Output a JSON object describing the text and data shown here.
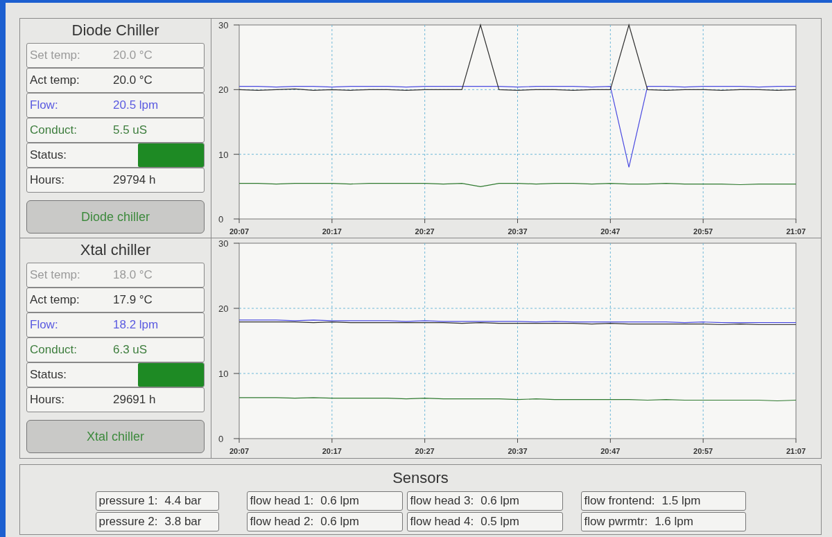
{
  "chillers": [
    {
      "title": "Diode Chiller",
      "rows": [
        {
          "kind": "setpoint",
          "label": "Set temp:",
          "value": "20.0 °C"
        },
        {
          "kind": "actual",
          "label": "Act temp:",
          "value": "20.0 °C"
        },
        {
          "kind": "flow",
          "label": "Flow:",
          "value": "20.5 lpm"
        },
        {
          "kind": "conduct",
          "label": "Conduct:",
          "value": "5.5 uS"
        },
        {
          "kind": "status",
          "label": "Status:",
          "color": "#1e8a24"
        },
        {
          "kind": "hours",
          "label": "Hours:",
          "value": "29794 h"
        }
      ],
      "button": "Diode chiller",
      "chart_data": {
        "type": "line",
        "grid": true,
        "categories": [
          "20:07",
          null,
          null,
          null,
          null,
          "20:17",
          null,
          null,
          null,
          null,
          "20:27",
          null,
          null,
          null,
          null,
          "20:37",
          null,
          null,
          null,
          null,
          "20:47",
          null,
          null,
          null,
          null,
          "20:57",
          null,
          null,
          null,
          null,
          "21:07"
        ],
        "ylim": [
          0,
          30
        ],
        "yticks": [
          0,
          10,
          20,
          30
        ],
        "series": [
          {
            "color": "#4a4ae0",
            "values": [
              20.5,
              20.5,
              20.4,
              20.5,
              20.5,
              20.4,
              20.5,
              20.5,
              20.5,
              20.4,
              20.5,
              20.5,
              20.5,
              20.5,
              20.5,
              20.4,
              20.5,
              20.5,
              20.5,
              20.4,
              20.5,
              8,
              20.5,
              20.5,
              20.4,
              20.5,
              20.5,
              20.5,
              20.4,
              20.5,
              20.5
            ]
          },
          {
            "color": "#303030",
            "values": [
              20.0,
              19.9,
              20.0,
              20.1,
              19.9,
              20.0,
              19.9,
              20.0,
              20.0,
              19.9,
              20.0,
              20.0,
              20.0,
              30,
              20.0,
              19.9,
              20.0,
              20.0,
              19.9,
              20.0,
              20.0,
              30,
              20.0,
              19.9,
              20.0,
              20.0,
              19.9,
              20.0,
              20.0,
              19.9,
              20.0
            ]
          },
          {
            "color": "#2f7a2f",
            "values": [
              5.5,
              5.5,
              5.4,
              5.5,
              5.5,
              5.5,
              5.4,
              5.5,
              5.5,
              5.5,
              5.5,
              5.4,
              5.5,
              5.0,
              5.5,
              5.5,
              5.4,
              5.5,
              5.5,
              5.4,
              5.5,
              5.4,
              5.4,
              5.5,
              5.4,
              5.4,
              5.4,
              5.3,
              5.4,
              5.4,
              5.4
            ]
          }
        ]
      }
    },
    {
      "title": "Xtal chiller",
      "rows": [
        {
          "kind": "setpoint",
          "label": "Set temp:",
          "value": "18.0 °C"
        },
        {
          "kind": "actual",
          "label": "Act temp:",
          "value": "17.9 °C"
        },
        {
          "kind": "flow",
          "label": "Flow:",
          "value": "18.2 lpm"
        },
        {
          "kind": "conduct",
          "label": "Conduct:",
          "value": "6.3 uS"
        },
        {
          "kind": "status",
          "label": "Status:",
          "color": "#1e8a24"
        },
        {
          "kind": "hours",
          "label": "Hours:",
          "value": "29691 h"
        }
      ],
      "button": "Xtal chiller",
      "chart_data": {
        "type": "line",
        "grid": true,
        "categories": [
          "20:07",
          null,
          null,
          null,
          null,
          "20:17",
          null,
          null,
          null,
          null,
          "20:27",
          null,
          null,
          null,
          null,
          "20:37",
          null,
          null,
          null,
          null,
          "20:47",
          null,
          null,
          null,
          null,
          "20:57",
          null,
          null,
          null,
          null,
          "21:07"
        ],
        "ylim": [
          0,
          30
        ],
        "yticks": [
          0,
          10,
          20,
          30
        ],
        "series": [
          {
            "color": "#4a4ae0",
            "values": [
              18.2,
              18.2,
              18.2,
              18.1,
              18.2,
              18.1,
              18.1,
              18.1,
              18.1,
              18.0,
              18.1,
              18.0,
              18.0,
              18.0,
              18.0,
              18.0,
              17.9,
              18.0,
              17.9,
              17.9,
              17.9,
              17.9,
              17.9,
              17.9,
              17.8,
              17.9,
              17.8,
              17.8,
              17.8,
              17.8,
              17.8
            ]
          },
          {
            "color": "#303030",
            "values": [
              17.9,
              17.9,
              17.9,
              17.9,
              17.8,
              17.9,
              17.8,
              17.8,
              17.8,
              17.8,
              17.8,
              17.8,
              17.7,
              17.8,
              17.7,
              17.7,
              17.7,
              17.7,
              17.7,
              17.6,
              17.7,
              17.6,
              17.6,
              17.6,
              17.6,
              17.6,
              17.5,
              17.6,
              17.5,
              17.5,
              17.5
            ]
          },
          {
            "color": "#2f7a2f",
            "values": [
              6.3,
              6.3,
              6.3,
              6.2,
              6.3,
              6.2,
              6.2,
              6.2,
              6.2,
              6.1,
              6.2,
              6.1,
              6.1,
              6.1,
              6.1,
              6.0,
              6.1,
              6.0,
              6.0,
              6.0,
              6.0,
              6.0,
              5.9,
              6.0,
              5.9,
              5.9,
              5.9,
              5.9,
              5.9,
              5.8,
              5.9
            ]
          }
        ]
      }
    }
  ],
  "sensors": {
    "title": "Sensors",
    "columns": [
      [
        {
          "label": "pressure 1:",
          "value": "4.4 bar"
        },
        {
          "label": "pressure 2:",
          "value": "3.8 bar"
        }
      ],
      [
        {
          "label": "flow head 1:",
          "value": "0.6 lpm"
        },
        {
          "label": "flow head 2:",
          "value": "0.6 lpm"
        }
      ],
      [
        {
          "label": "flow head 3:",
          "value": "0.6 lpm"
        },
        {
          "label": "flow head 4:",
          "value": "0.5 lpm"
        }
      ],
      [
        {
          "label": "flow frontend:",
          "value": "1.5 lpm"
        },
        {
          "label": "flow pwrmtr:",
          "value": "1.6 lpm"
        }
      ]
    ]
  }
}
